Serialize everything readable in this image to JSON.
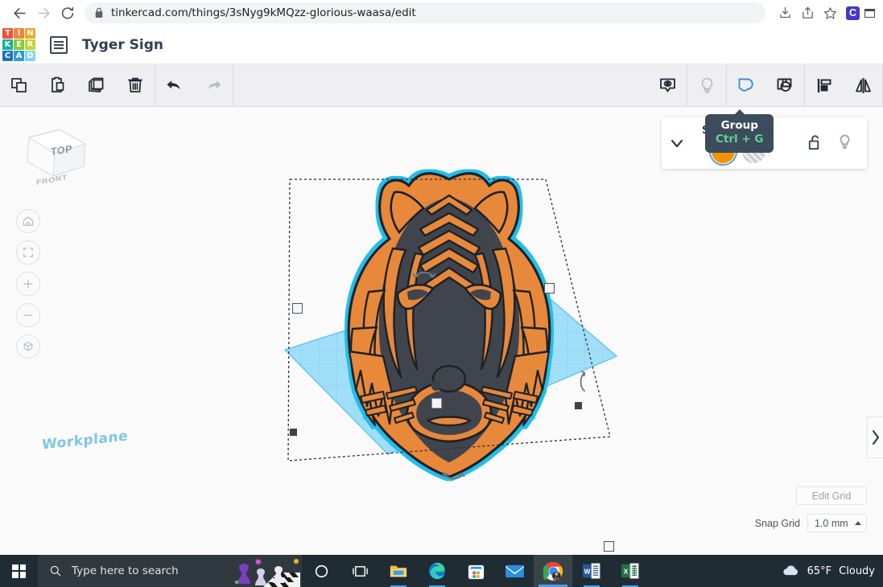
{
  "browser": {
    "back_icon": "arrow-back-icon",
    "forward_icon": "arrow-forward-icon",
    "reload_icon": "reload-icon",
    "lock_icon": "lock-icon",
    "url": "tinkercad.com/things/3sNyg9kMQzz-glorious-waasa/edit",
    "install_icon": "install-app-icon",
    "share_icon": "share-icon",
    "bookmark_icon": "star-icon",
    "extension_label": "C"
  },
  "app_header": {
    "logo_letters": [
      "T",
      "I",
      "N",
      "K",
      "E",
      "R",
      "C",
      "A",
      "D"
    ],
    "logo_colors": [
      "#F0513C",
      "#F5833A",
      "#F5A623",
      "#16B096",
      "#8CC63E",
      "#BFD730",
      "#1B75BB",
      "#2E9BD6",
      "#7FD4F0"
    ],
    "menu_icon": "list-menu-icon",
    "title": "Tyger Sign"
  },
  "toolbar": {
    "left_tools": [
      {
        "name": "copy-button",
        "icon": "copy-icon",
        "enabled": true
      },
      {
        "name": "paste-button",
        "icon": "paste-icon",
        "enabled": true
      },
      {
        "name": "duplicate-button",
        "icon": "duplicate-icon",
        "enabled": true
      },
      {
        "name": "delete-button",
        "icon": "trash-icon",
        "enabled": true
      },
      {
        "name": "undo-button",
        "icon": "undo-arrow-icon",
        "enabled": true
      },
      {
        "name": "redo-button",
        "icon": "redo-arrow-icon",
        "enabled": false
      }
    ],
    "right_tools": [
      {
        "name": "notes-button",
        "icon": "note-eye-icon",
        "enabled": true
      },
      {
        "name": "light-button",
        "icon": "lightbulb-icon",
        "enabled": false
      },
      {
        "name": "group-button",
        "icon": "group-shapes-icon",
        "enabled": true,
        "active": true
      },
      {
        "name": "ungroup-button",
        "icon": "ungroup-shapes-icon",
        "enabled": true
      },
      {
        "name": "align-button",
        "icon": "align-icon",
        "enabled": true
      },
      {
        "name": "mirror-button",
        "icon": "mirror-flip-icon",
        "enabled": true
      }
    ]
  },
  "tooltip": {
    "title": "Group",
    "shortcut": "Ctrl + G",
    "bg_color": "#3D4C5C",
    "shortcut_color": "#5FD38D"
  },
  "shape_panel": {
    "title": "Shapes (2)",
    "collapse_icon": "chevron-down-icon",
    "solid_swatch": "solid-shape-swatch",
    "hole_swatch": "hole-shape-swatch",
    "lock_icon": "unlock-icon",
    "light_icon": "lightbulb-icon"
  },
  "viewport": {
    "view_cube": {
      "top_face_label": "TOP",
      "front_face_label": "FRONT"
    },
    "nav_buttons": [
      {
        "name": "home-view-button",
        "icon": "home-icon"
      },
      {
        "name": "fit-to-view-button",
        "icon": "fit-frame-icon"
      },
      {
        "name": "zoom-in-button",
        "icon": "plus-icon"
      },
      {
        "name": "zoom-out-button",
        "icon": "minus-icon"
      },
      {
        "name": "ortho-perspective-button",
        "icon": "cube-box-icon"
      }
    ],
    "workplane_label": "Workplane",
    "drawer_toggle_icon": "chevron-right-icon",
    "model_colors": {
      "orange": "#E8883A",
      "dark": "#3F444E",
      "selection_glow": "#22BDEC",
      "workplane": "#8ED8F8"
    }
  },
  "grid_controls": {
    "edit_grid_label": "Edit Grid",
    "snap_grid_label": "Snap Grid",
    "snap_grid_value": "1.0 mm",
    "snap_caret_icon": "caret-up-icon"
  },
  "taskbar": {
    "start_icon": "windows-start-icon",
    "search_icon": "search-icon",
    "search_placeholder": "Type here to search",
    "items": [
      {
        "name": "taskbar-cortana",
        "icon": "cortana-circle-icon"
      },
      {
        "name": "taskbar-task-view",
        "icon": "task-view-icon"
      },
      {
        "name": "taskbar-file-explorer",
        "icon": "folder-icon"
      },
      {
        "name": "taskbar-edge",
        "icon": "edge-icon"
      },
      {
        "name": "taskbar-store",
        "icon": "microsoft-store-icon"
      },
      {
        "name": "taskbar-mail",
        "icon": "mail-icon"
      },
      {
        "name": "taskbar-chrome",
        "icon": "chrome-icon"
      },
      {
        "name": "taskbar-word",
        "icon": "word-icon"
      },
      {
        "name": "taskbar-excel",
        "icon": "excel-icon"
      }
    ],
    "weather": {
      "icon": "cloud-icon",
      "temperature": "65°F",
      "condition": "Cloudy"
    }
  }
}
